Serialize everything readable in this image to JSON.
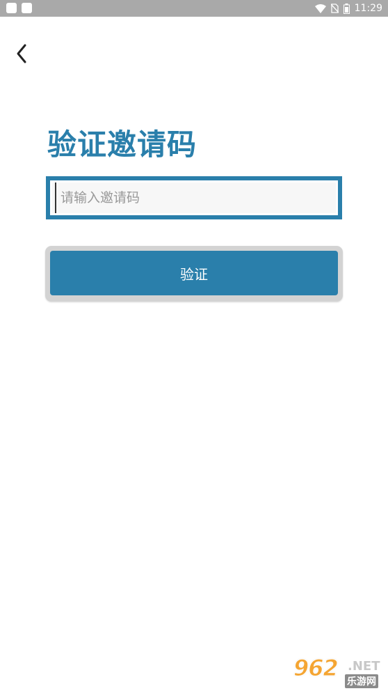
{
  "status_bar": {
    "time": "11:29",
    "icons": [
      "wifi-icon",
      "no-sim-icon",
      "battery-icon"
    ]
  },
  "nav": {
    "back_icon": "chevron-left-icon"
  },
  "page": {
    "title": "验证邀请码",
    "invite_input": {
      "placeholder": "请输入邀请码",
      "value": ""
    },
    "verify_button": "验证"
  },
  "watermark": {
    "number": "962",
    "suffix": ".NET",
    "site_name": "乐游网"
  },
  "colors": {
    "accent": "#2a7fab",
    "status_bar": "#a9a9a9",
    "button_frame": "#d3d3d3",
    "watermark_orange": "#f4a533"
  }
}
